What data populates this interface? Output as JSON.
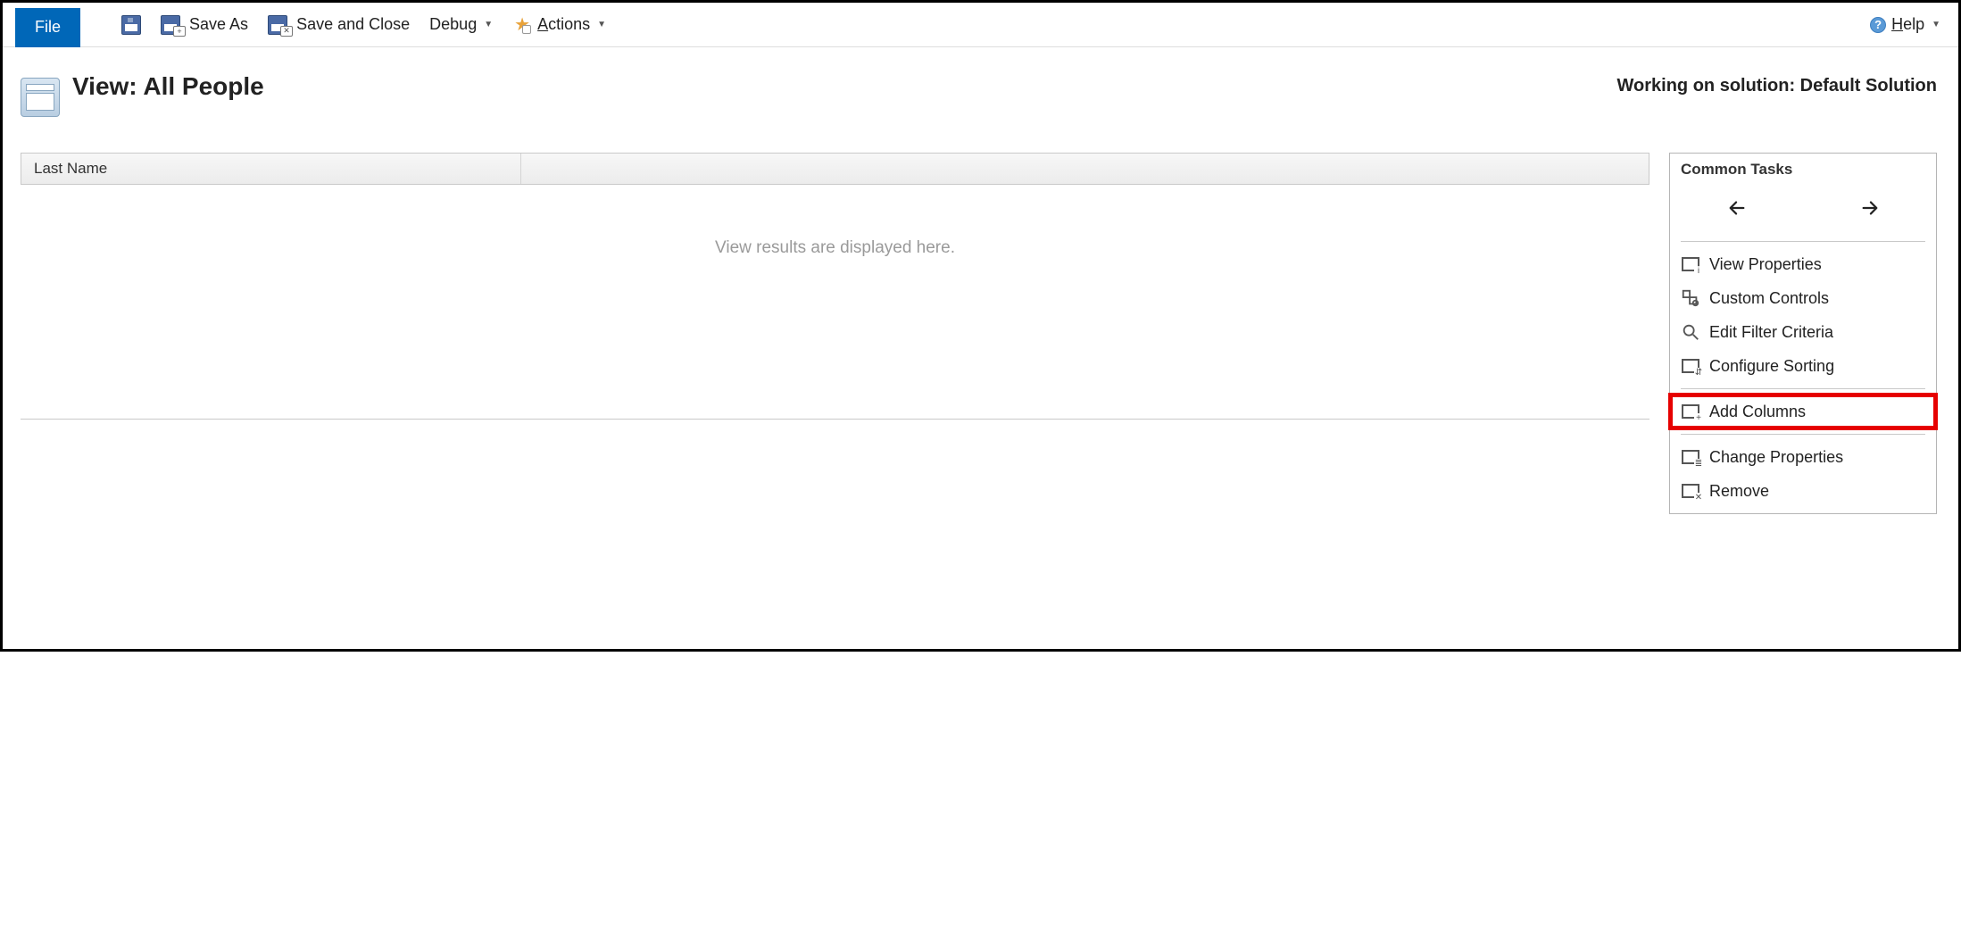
{
  "toolbar": {
    "file_label": "File",
    "save_as_label": "Save As",
    "save_and_close_label": "Save and Close",
    "debug_label": "Debug",
    "actions_label_prefix": "A",
    "actions_label_rest": "ctions",
    "help_label_prefix": "H",
    "help_label_rest": "elp"
  },
  "page": {
    "title": "View: All People",
    "solution_label": "Working on solution: Default Solution"
  },
  "grid": {
    "columns": [
      "Last Name",
      ""
    ],
    "empty_placeholder": "View results are displayed here."
  },
  "tasks": {
    "title": "Common Tasks",
    "items": {
      "view_properties": "View Properties",
      "custom_controls": "Custom Controls",
      "edit_filter_criteria": "Edit Filter Criteria",
      "configure_sorting": "Configure Sorting",
      "add_columns": "Add Columns",
      "change_properties": "Change Properties",
      "remove": "Remove"
    }
  }
}
